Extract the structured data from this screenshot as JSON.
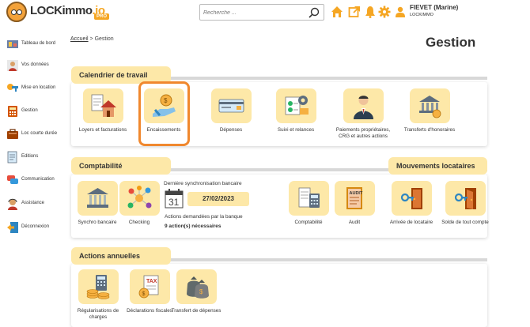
{
  "header": {
    "logo_text": "LOCKimmo",
    "logo_suffix": ".io",
    "logo_badge": "PRO",
    "search_placeholder": "Recherche ...",
    "user_name": "FIEVET (Marine)",
    "user_company": "LOCKIMMO",
    "icons": [
      "home-icon",
      "external-link-icon",
      "bell-icon",
      "gear-icon",
      "user-icon"
    ],
    "accent_color": "#f5a623"
  },
  "sidebar": {
    "items": [
      {
        "label": "Tableau de bord",
        "icon": "dashboard-icon"
      },
      {
        "label": "Vos données",
        "icon": "profile-icon"
      },
      {
        "label": "Mise en location",
        "icon": "key-icon"
      },
      {
        "label": "Gestion",
        "icon": "calculator-icon"
      },
      {
        "label": "Loc courte durée",
        "icon": "suitcase-icon"
      },
      {
        "label": "Editions",
        "icon": "document-icon"
      },
      {
        "label": "Communication",
        "icon": "chat-icon"
      },
      {
        "label": "Assistance",
        "icon": "support-icon"
      },
      {
        "label": "Déconnexion",
        "icon": "logout-icon"
      }
    ]
  },
  "breadcrumb": {
    "home": "Accueil",
    "separator": ">",
    "current": "Gestion"
  },
  "page_title": "Gestion",
  "calendrier": {
    "title": "Calendrier de travail",
    "tiles": [
      {
        "label": "Loyers et facturations",
        "icon": "invoice-house-icon"
      },
      {
        "label": "Encaissements",
        "icon": "coin-hand-icon"
      },
      {
        "label": "Dépenses",
        "icon": "payment-card-icon"
      },
      {
        "label": "Suivi et relances",
        "icon": "followup-icon"
      },
      {
        "label": "Paiements propriétaires, CRG et autres actions",
        "icon": "owner-icon"
      },
      {
        "label": "Transferts d'honoraires",
        "icon": "transfer-fees-icon"
      }
    ]
  },
  "comptabilite": {
    "title": "Comptabilité",
    "tiles": [
      {
        "label": "Synchro bancaire",
        "icon": "bank-icon"
      },
      {
        "label": "Checking",
        "icon": "network-icon"
      },
      {
        "label": "Comptabilité",
        "icon": "ledger-icon"
      },
      {
        "label": "Audit",
        "icon": "audit-icon"
      }
    ],
    "sync_label": "Dernière synchronisation bancaire",
    "calendar_day": "31",
    "sync_date": "27/02/2023",
    "actions_label": "Actions demandées par la banque",
    "actions_count": "9 action(s) nécessaires"
  },
  "mouvements": {
    "title": "Mouvements locataires",
    "tiles": [
      {
        "label": "Arrivée de locataire",
        "icon": "door-arrival-icon"
      },
      {
        "label": "Solde de tout compte",
        "icon": "door-exit-icon"
      }
    ]
  },
  "annuelles": {
    "title": "Actions annuelles",
    "tiles": [
      {
        "label": "Régularisations de charges",
        "icon": "coins-calculator-icon"
      },
      {
        "label": "Déclarations fiscales",
        "icon": "tax-icon"
      },
      {
        "label": "Transfert de dépenses",
        "icon": "money-bags-icon"
      }
    ]
  },
  "colors": {
    "tile_bg": "#fde8a8",
    "highlight": "#f0882e",
    "section_bar": "#d8d8d8"
  }
}
